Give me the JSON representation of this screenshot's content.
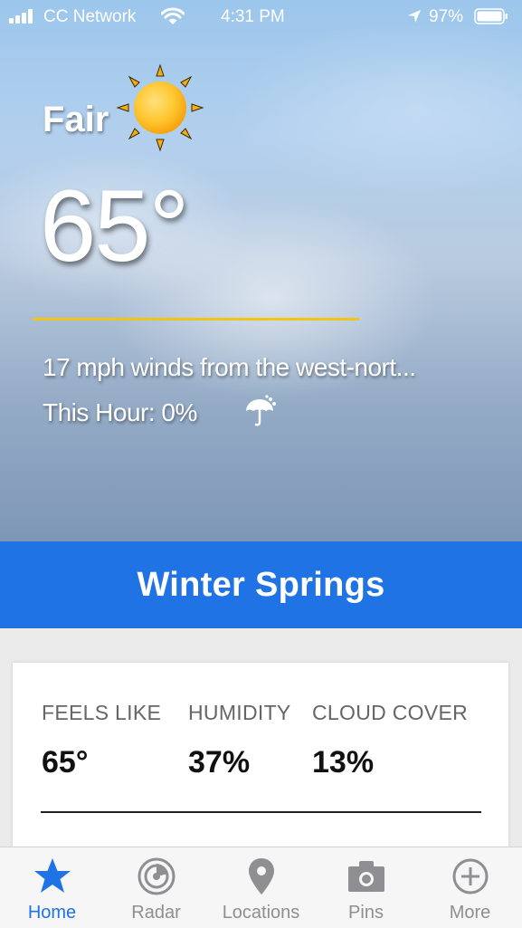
{
  "status_bar": {
    "carrier": "CC Network",
    "time": "4:31 PM",
    "battery": "97%"
  },
  "current": {
    "condition": "Fair",
    "condition_icon": "sun-icon",
    "temperature": "65°",
    "wind": "17 mph winds from the west-nort...",
    "precip": "This Hour: 0%",
    "precip_icon": "umbrella-rain-icon"
  },
  "location": {
    "city": "Winter Springs"
  },
  "details": [
    {
      "label": "FEELS LIKE",
      "value": "65°"
    },
    {
      "label": "HUMIDITY",
      "value": "37%"
    },
    {
      "label": "CLOUD COVER",
      "value": "13%"
    }
  ],
  "tabs": [
    {
      "label": "Home",
      "icon": "star-icon",
      "active": true
    },
    {
      "label": "Radar",
      "icon": "radar-icon",
      "active": false
    },
    {
      "label": "Locations",
      "icon": "map-pin-icon",
      "active": false
    },
    {
      "label": "Pins",
      "icon": "camera-icon",
      "active": false
    },
    {
      "label": "More",
      "icon": "plus-circle-icon",
      "active": false
    }
  ],
  "colors": {
    "accent": "#1f73e4",
    "divider": "#f0c419",
    "tab_inactive": "#8e8e93"
  }
}
